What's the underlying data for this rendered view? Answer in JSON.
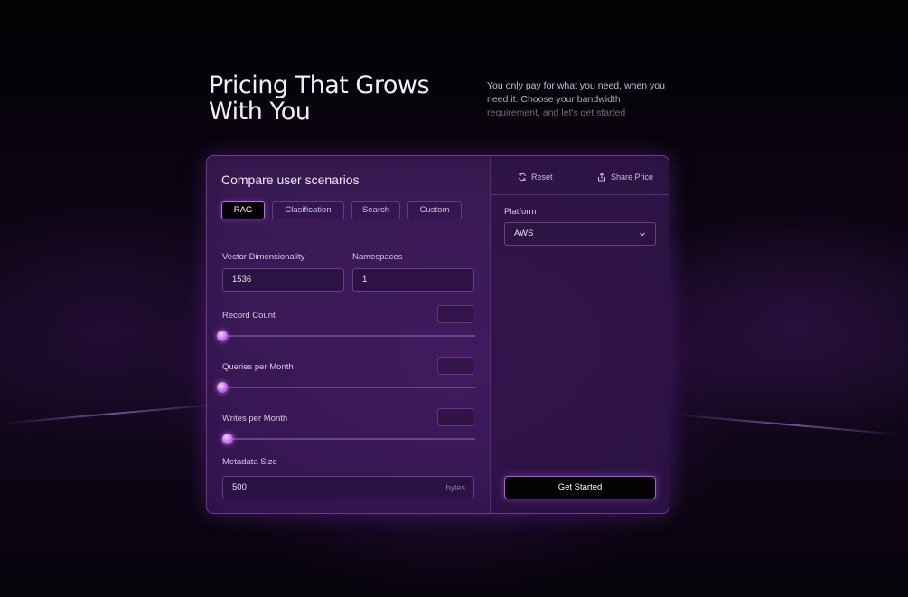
{
  "hero": {
    "title": "Pricing That Grows With You",
    "description": "You only pay for what you need, when you need it. Choose your bandwidth requirement, and let's get started"
  },
  "calculator": {
    "title": "Compare user scenarios",
    "tabs": [
      {
        "label": "RAG",
        "active": true
      },
      {
        "label": "Clasification",
        "active": false
      },
      {
        "label": "Search",
        "active": false
      },
      {
        "label": "Custom",
        "active": false
      }
    ],
    "vector_dimensionality": {
      "label": "Vector Dimensionality",
      "value": "1536"
    },
    "namespaces": {
      "label": "Namespaces",
      "value": "1"
    },
    "record_count": {
      "label": "Record Count",
      "slider_fraction": 0.0
    },
    "queries_per_month": {
      "label": "Queries per Month",
      "slider_fraction": 0.0
    },
    "writes_per_month": {
      "label": "Writes per Month",
      "slider_fraction": 0.02
    },
    "metadata_size": {
      "label": "Metadata Size",
      "value": "500",
      "unit": "bytes"
    }
  },
  "sidebar": {
    "reset_label": "Reset",
    "share_label": "Share Price",
    "platform_label": "Platform",
    "platform_value": "AWS",
    "cta_label": "Get Started"
  },
  "colors": {
    "accent": "#b36ae8",
    "card_border": "#6d3a93",
    "background": "#050208"
  },
  "icons": [
    "refresh-icon",
    "share-icon",
    "chevron-down-icon"
  ]
}
